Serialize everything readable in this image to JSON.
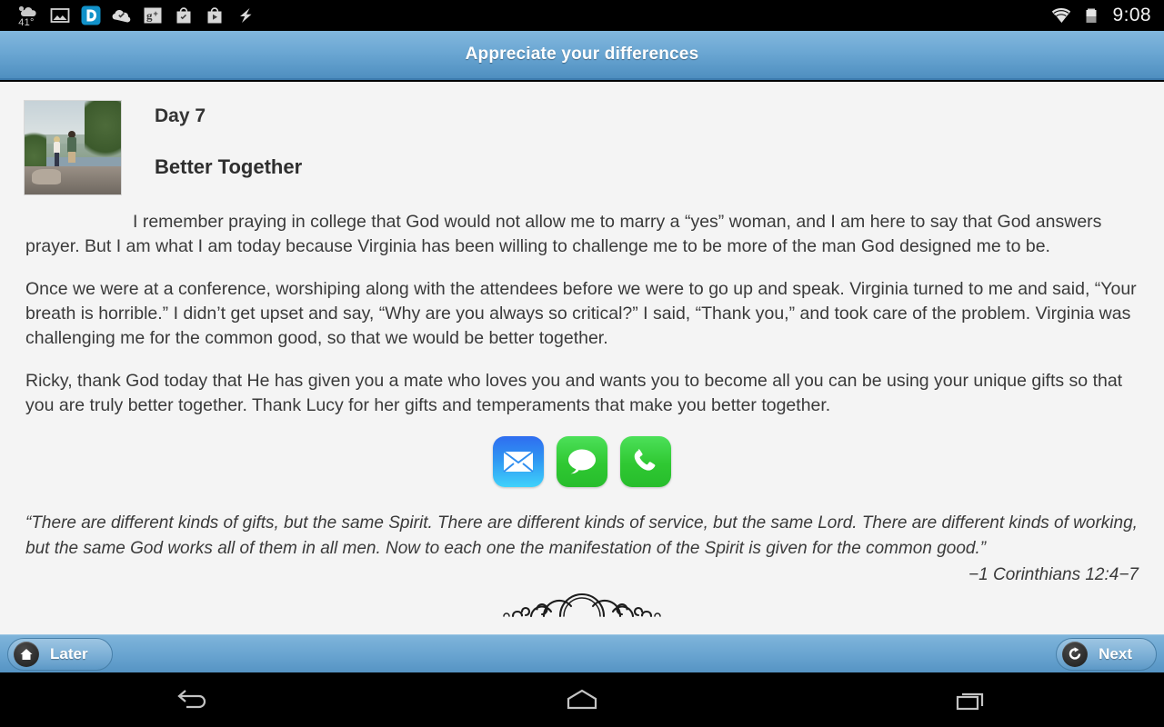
{
  "status_bar": {
    "weather_temp": "41°",
    "icons": [
      {
        "name": "weather-icon",
        "label": "41°"
      },
      {
        "name": "gallery-icon",
        "label": "Gallery"
      },
      {
        "name": "dashlane-icon",
        "label": "D"
      },
      {
        "name": "google-drive-icon",
        "label": "Drive"
      },
      {
        "name": "google-plus-icon",
        "label": "g+"
      },
      {
        "name": "play-store-check-icon",
        "label": "Play"
      },
      {
        "name": "play-store-video-icon",
        "label": "Play Movies"
      },
      {
        "name": "lightning-icon",
        "label": "Charging"
      }
    ],
    "wifi": "wifi-icon",
    "battery": "battery-icon",
    "time": "9:08"
  },
  "title_bar": {
    "title": "Appreciate your differences"
  },
  "article": {
    "day_label": "Day 7",
    "title": "Better Together",
    "paragraphs": [
      "I remember praying in college that God would not allow me to marry a “yes” woman, and I am here to say that God answers prayer. But I am what I am today because Virginia has been willing to challenge me to be more of the man God designed me to be.",
      "Once we were at a conference, worshiping along with the attendees before we were to go up and speak. Virginia turned to me and said, “Your breath is horrible.” I didn’t get upset and say, “Why are you always so critical?” I said, “Thank you,” and took care of the problem. Virginia was challenging me for the common good, so that we would be better together.",
      "Ricky, thank God today that He has given you a mate who loves you and wants you to become all you can be using your unique gifts so that you are truly better together. Thank Lucy for her gifts and temperaments that make you better together."
    ],
    "scripture": "“There are different kinds of gifts, but the same Spirit. There are different kinds of service, but the same Lord. There are different kinds of working, but the same God works all of them in all men. Now to each one the manifestation of the Spirit is given for the common good.”",
    "attribution": "−1 Corinthians 12:4−7"
  },
  "share_buttons": [
    {
      "name": "email-share-button",
      "label": "Email"
    },
    {
      "name": "message-share-button",
      "label": "Message"
    },
    {
      "name": "phone-share-button",
      "label": "Call"
    }
  ],
  "action_bar": {
    "later_label": "Later",
    "next_label": "Next"
  },
  "nav_bar": {
    "back_label": "Back",
    "home_label": "Home",
    "recents_label": "Recent apps"
  },
  "colors": {
    "title_bar_blue": "#6ba7d3",
    "action_bar_blue": "#6aa5d1",
    "content_bg": "#f4f4f4",
    "mail_icon_blue": "#2f96f2",
    "message_icon_green": "#2fc832"
  }
}
